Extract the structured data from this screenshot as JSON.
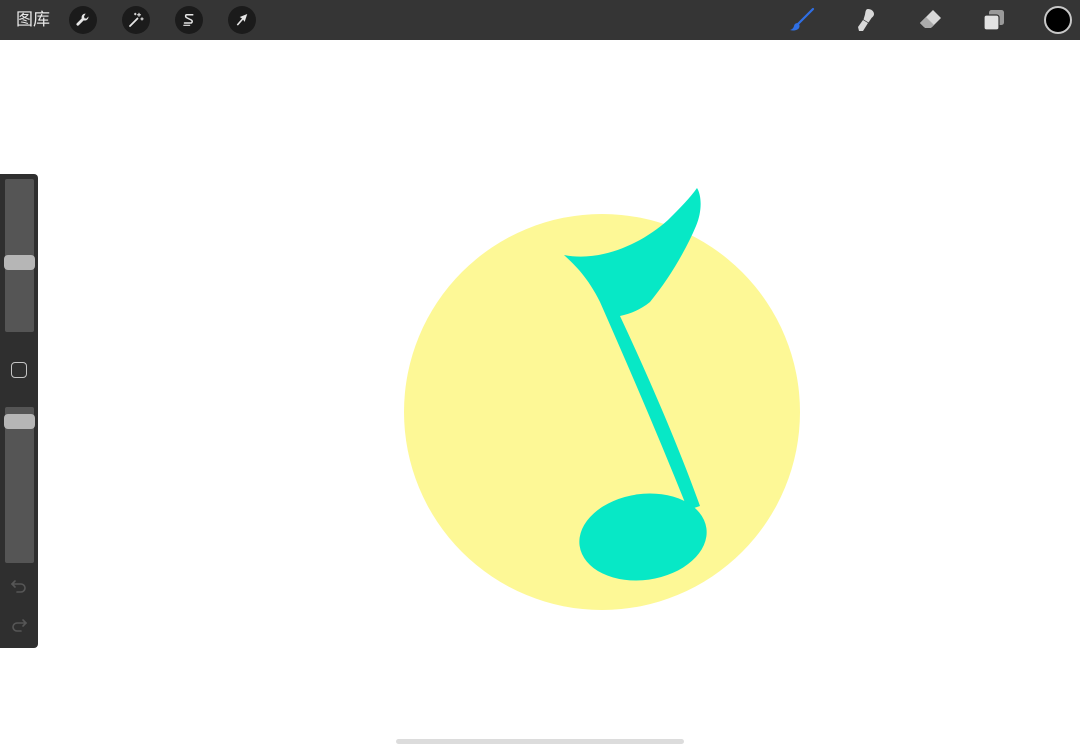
{
  "toolbar": {
    "gallery_label": "图库",
    "left_tools": [
      {
        "name": "actions",
        "icon": "wrench-icon"
      },
      {
        "name": "adjustments",
        "icon": "magic-wand-icon"
      },
      {
        "name": "selection",
        "icon": "selection-s-icon"
      },
      {
        "name": "transform",
        "icon": "arrow-cursor-icon"
      }
    ],
    "right_tools": [
      {
        "name": "brush",
        "icon": "brush-icon",
        "active": true,
        "color": "#2f6fe4"
      },
      {
        "name": "smudge",
        "icon": "smudge-icon",
        "active": false
      },
      {
        "name": "eraser",
        "icon": "eraser-icon",
        "active": false
      },
      {
        "name": "layers",
        "icon": "layers-icon",
        "active": false
      }
    ],
    "current_color": "#000000"
  },
  "sidebar": {
    "brush_size_level": 0.45,
    "opacity_level": 0.95,
    "modify_icon": "square-outline-icon",
    "undo_icon": "undo-icon",
    "redo_icon": "redo-icon"
  },
  "canvas": {
    "background": "#ffffff",
    "circle_color": "#fdf896",
    "note_color": "#07e8c6"
  }
}
